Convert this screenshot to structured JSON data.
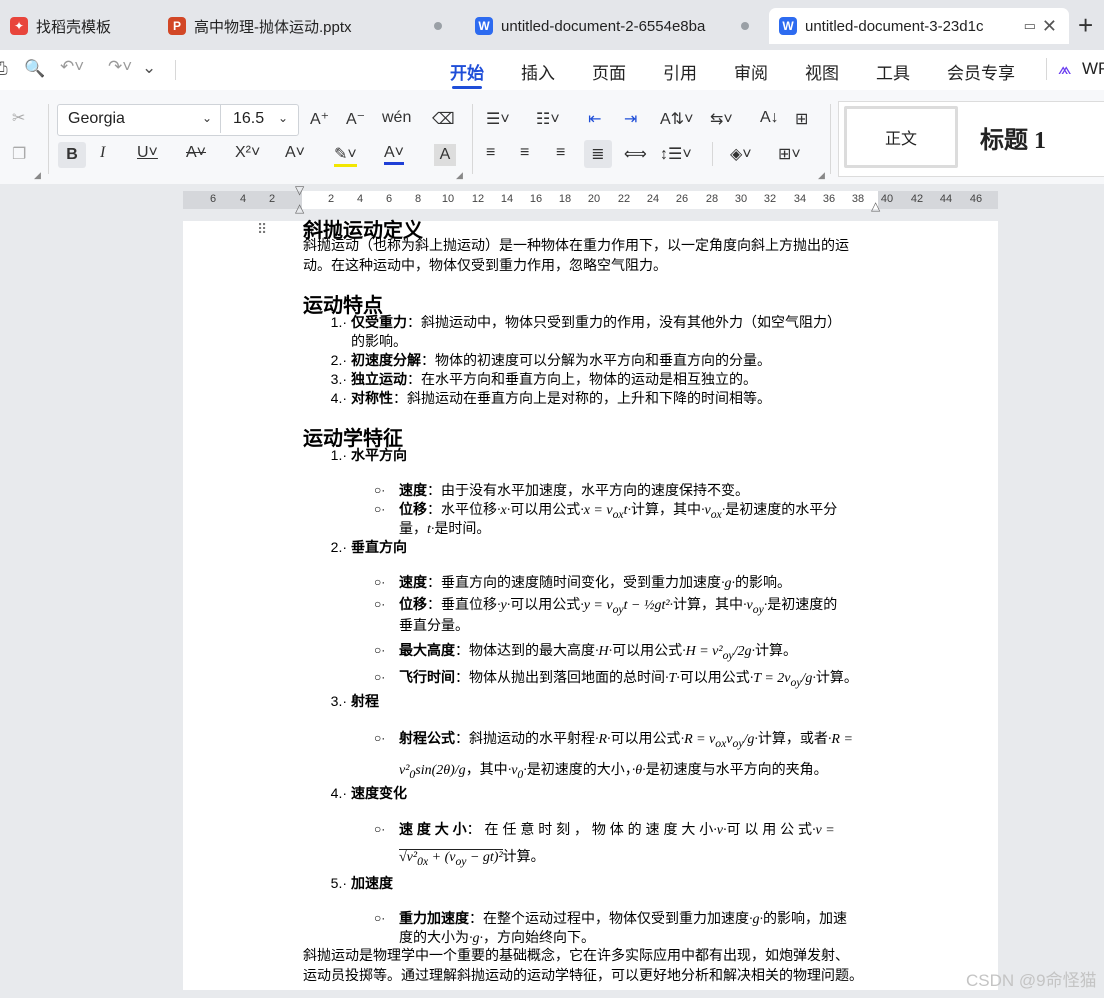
{
  "tabs": [
    {
      "label": "找稻壳模板",
      "icon": "docer-icon",
      "color": "#e8453c"
    },
    {
      "label": "高中物理-抛体运动.pptx",
      "icon": "ppt-icon",
      "color": "#d24726"
    },
    {
      "label": "untitled-document-2-6554e8ba",
      "icon": "wps-writer-icon",
      "color": "#2d6bf0"
    },
    {
      "label": "untitled-document-3-23d1c",
      "icon": "wps-writer-icon",
      "color": "#2d6bf0"
    }
  ],
  "menu": [
    "开始",
    "插入",
    "页面",
    "引用",
    "审阅",
    "视图",
    "工具",
    "会员专享",
    "WPS"
  ],
  "active_menu": "开始",
  "font": {
    "name": "Georgia",
    "size": "16.5"
  },
  "styles": [
    "正文",
    "标题 1"
  ],
  "ruler_ticks": [
    "6",
    "4",
    "2",
    "2",
    "4",
    "6",
    "8",
    "10",
    "12",
    "14",
    "16",
    "18",
    "20",
    "22",
    "24",
    "26",
    "28",
    "30",
    "32",
    "34",
    "36",
    "38",
    "40",
    "42",
    "44",
    "46"
  ],
  "doc": {
    "h0": "斜抛运动定义",
    "p0a": "斜抛运动（也称为斜上抛运动）是一种物体在重力作用下，以一定角度向斜上方抛出的运",
    "p0b": "动。在这种运动中，物体仅受到重力作用，忽略空气阻力。",
    "h1": "运动特点",
    "f1b": "仅受重力",
    "f1t": "：斜抛运动中，物体只受到重力的作用，没有其他外力（如空气阻力）",
    "f1t2": "的影响。",
    "f2b": "初速度分解",
    "f2t": "：物体的初速度可以分解为水平方向和垂直方向的分量。",
    "f3b": "独立运动",
    "f3t": "：在水平方向和垂直方向上，物体的运动是相互独立的。",
    "f4b": "对称性",
    "f4t": "：斜抛运动在垂直方向上是对称的，上升和下降的时间相等。",
    "h2": "运动学特征",
    "k1": "水平方向",
    "k1a_b": "速度",
    "k1a_t": "：由于没有水平加速度，水平方向的速度保持不变。",
    "k1b_b": "位移",
    "k1b_t1": "：水平位移",
    "k1b_t2": "可以用公式",
    "k1b_t3": "计算，其中",
    "k1b_t4": "是初速度的水平分",
    "k1b_t5": "量，",
    "k1b_t6": "是时间。",
    "k2": "垂直方向",
    "k2a_b": "速度",
    "k2a_t1": "：垂直方向的速度随时间变化，受到重力加速度",
    "k2a_t2": "的影响。",
    "k2b_b": "位移",
    "k2b_t1": "：垂直位移",
    "k2b_t2": "可以用公式",
    "k2b_t3": "计算，其中",
    "k2b_t4": "是初速度的",
    "k2b_t5": "垂直分量。",
    "k2c_b": "最大高度",
    "k2c_t1": "：物体达到的最大高度",
    "k2c_t2": "可以用公式",
    "k2c_t3": "计算。",
    "k2d_b": "飞行时间",
    "k2d_t1": "：物体从抛出到落回地面的总时间",
    "k2d_t2": "可以用公式",
    "k2d_t3": "计算。",
    "k3": "射程",
    "k3a_b": "射程公式",
    "k3a_t1": "：斜抛运动的水平射程",
    "k3a_t2": "可以用公式",
    "k3a_t3": "计算，或者",
    "k3a_t4": "，其中",
    "k3a_t5": "是初速度的大小，",
    "k3a_t6": "是初速度与水平方向的夹角。",
    "k4": "速度变化",
    "k4a_b": "速 度 大 小",
    "k4a_t1": "： 在 任 意 时 刻 ， 物 体 的 速 度 大 小",
    "k4a_t2": "可 以 用 公 式",
    "k4a_t3": "计算。",
    "k5": "加速度",
    "k5a_b": "重力加速度",
    "k5a_t1": "：在整个运动过程中，物体仅受到重力加速度",
    "k5a_t2": "的影响，加速",
    "k5a_t3": "度的大小为",
    "k5a_t4": "，方向始终向下。",
    "pa": "斜抛运动是物理学中一个重要的基础概念，它在许多实际应用中都有出现，如炮弹发射、",
    "pb": "运动员投掷等。通过理解斜抛运动的运动学特征，可以更好地分析和解决相关的物理问题。"
  },
  "watermark": "CSDN @9命怪猫"
}
